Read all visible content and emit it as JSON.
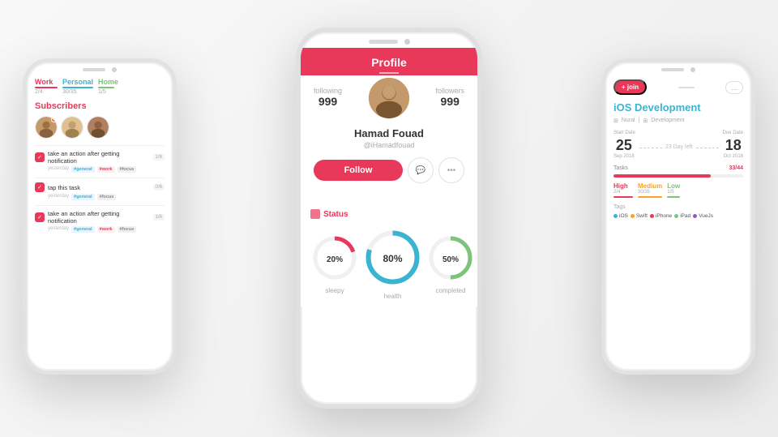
{
  "left_phone": {
    "tabs": [
      {
        "label": "Work",
        "class": "work",
        "sub": "2/4"
      },
      {
        "label": "Personal",
        "class": "personal",
        "sub": "30/35"
      },
      {
        "label": "Home",
        "class": "home",
        "sub": "1/5"
      }
    ],
    "subscribers_title": "Subscribers",
    "tasks": [
      {
        "text": "take an action after getting notification",
        "badge": "1/6",
        "date": "yesterday",
        "tags": [
          "#general",
          "#work",
          "#focus"
        ]
      },
      {
        "text": "tap this task",
        "badge": "0/6",
        "date": "yesterday",
        "tags": [
          "#general",
          "#focus"
        ]
      },
      {
        "text": "take an action after getting notification",
        "badge": "1/6",
        "date": "yesterday",
        "tags": [
          "#general",
          "#work",
          "#focus"
        ]
      }
    ]
  },
  "center_phone": {
    "header_title": "Profile",
    "following_label": "following",
    "following_count": "999",
    "followers_label": "followers",
    "followers_count": "999",
    "name": "Hamad Fouad",
    "handle": "@iHamadfouad",
    "follow_button": "Follow",
    "status_title": "Status",
    "circles": [
      {
        "label": "sleepy",
        "percent": 20,
        "color": "#e8395a",
        "bg": "#f0f0f0"
      },
      {
        "label": "health",
        "percent": 80,
        "color": "#3ab4d0",
        "bg": "#f0f0f0"
      },
      {
        "label": "completed",
        "percent": 50,
        "color": "#7dc47a",
        "bg": "#f0f0f0"
      }
    ]
  },
  "right_phone": {
    "join_label": "+ join",
    "dots_label": "...",
    "project_title": "iOS Development",
    "meta_icon": "⊞",
    "meta_nural": "Nural",
    "meta_dev": "Development",
    "start_date_label": "Start Date",
    "start_day": "25",
    "start_month": "Sep 2018",
    "due_date_label": "Due Date",
    "due_day": "18",
    "due_month": "Oct 2018",
    "days_left": "23 Day left",
    "tasks_label": "Tasks",
    "tasks_count": "33/44",
    "priorities": [
      {
        "label": "High",
        "class": "high",
        "sub": "2/4"
      },
      {
        "label": "Medium",
        "class": "medium",
        "sub": "30/35"
      },
      {
        "label": "Low",
        "class": "low",
        "sub": "1/5"
      }
    ],
    "tags_label": "Tags",
    "tech_tags": [
      {
        "name": "iOS",
        "color": "#3ab4d0"
      },
      {
        "name": "Swift",
        "color": "#f5a623"
      },
      {
        "name": "iPhone",
        "color": "#e8395a"
      },
      {
        "name": "iPad",
        "color": "#7dc47a"
      },
      {
        "name": "VueJs",
        "color": "#9b59b6"
      }
    ]
  }
}
